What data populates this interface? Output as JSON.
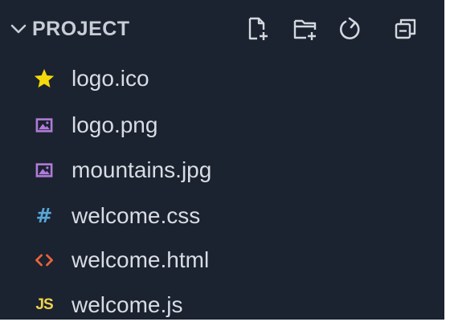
{
  "panel": {
    "title": "PROJECT",
    "actions": [
      {
        "name": "new-file-button",
        "icon": "new-file-icon"
      },
      {
        "name": "new-folder-button",
        "icon": "new-folder-icon"
      },
      {
        "name": "refresh-button",
        "icon": "refresh-icon"
      },
      {
        "name": "collapse-all-button",
        "icon": "collapse-all-icon"
      }
    ]
  },
  "files": [
    {
      "name": "logo.ico",
      "icon": "star-icon"
    },
    {
      "name": "logo.png",
      "icon": "image-icon"
    },
    {
      "name": "mountains.jpg",
      "icon": "image-icon"
    },
    {
      "name": "welcome.css",
      "icon": "css-hash-icon",
      "glyph": "#"
    },
    {
      "name": "welcome.html",
      "icon": "html-brackets-icon"
    },
    {
      "name": "welcome.js",
      "icon": "js-icon",
      "glyph": "JS"
    }
  ],
  "colors": {
    "background": "#1b2230",
    "text": "#d8dce3",
    "star": "#f5d90a",
    "image": "#b07cd8",
    "css": "#58a6d6",
    "html": "#e8643a",
    "js": "#f1d34c"
  }
}
